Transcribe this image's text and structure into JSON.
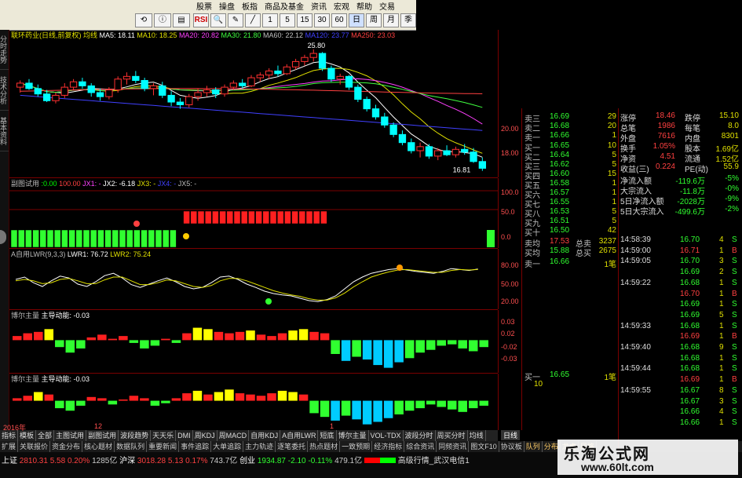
{
  "menu": [
    "股票",
    "操盘",
    "板指",
    "商品及基金",
    "资讯",
    "宏观",
    "帮助",
    "交易"
  ],
  "toolbar": {
    "buttons": [
      "RSI",
      "Q",
      "1",
      "5",
      "15",
      "30",
      "60",
      "日",
      "周",
      "月",
      "季",
      "年"
    ]
  },
  "sidebar": {
    "tabs": [
      "分时走势",
      "技术分析",
      "基本资料"
    ]
  },
  "main_chart": {
    "title": "联环药业(日线,前复权) 均线",
    "ma": [
      {
        "label": "MA5: 18.11",
        "color": "#ffffff"
      },
      {
        "label": "MA10: 18.25",
        "color": "#e0e000"
      },
      {
        "label": "MA20: 20.82",
        "color": "#ff40ff"
      },
      {
        "label": "MA30: 21.80",
        "color": "#40ff40"
      },
      {
        "label": "MA60: 22.12",
        "color": "#c0c0c0"
      },
      {
        "label": "MA120: 23.77",
        "color": "#4040ff"
      },
      {
        "label": "MA250: 23.03",
        "color": "#ff4040"
      }
    ],
    "high_label": "25.80",
    "low_label": "16.81",
    "y_ticks": [
      "20.00",
      "18.00"
    ],
    "candles": [
      [
        23.0,
        23.5,
        22.6,
        23.3
      ],
      [
        23.3,
        23.6,
        22.8,
        22.9
      ],
      [
        22.9,
        23.2,
        22.3,
        22.5
      ],
      [
        22.5,
        22.8,
        21.9,
        22.0
      ],
      [
        22.0,
        22.6,
        21.8,
        22.4
      ],
      [
        22.4,
        23.3,
        22.2,
        23.0
      ],
      [
        23.0,
        23.6,
        22.8,
        23.4
      ],
      [
        23.4,
        23.7,
        22.9,
        23.1
      ],
      [
        23.1,
        23.3,
        22.3,
        22.6
      ],
      [
        22.6,
        22.9,
        22.0,
        22.3
      ],
      [
        22.3,
        23.0,
        22.1,
        22.8
      ],
      [
        22.8,
        23.8,
        22.6,
        23.6
      ],
      [
        23.6,
        24.1,
        23.2,
        23.8
      ],
      [
        23.8,
        24.2,
        23.3,
        23.5
      ],
      [
        23.5,
        23.7,
        22.7,
        22.9
      ],
      [
        22.9,
        23.3,
        22.4,
        23.1
      ],
      [
        23.1,
        23.4,
        22.2,
        22.4
      ],
      [
        22.4,
        22.7,
        21.6,
        21.9
      ],
      [
        21.9,
        22.2,
        21.4,
        21.7
      ],
      [
        21.7,
        22.5,
        21.5,
        22.3
      ],
      [
        22.3,
        22.9,
        22.0,
        22.6
      ],
      [
        22.6,
        23.1,
        22.3,
        22.8
      ],
      [
        22.8,
        23.0,
        22.2,
        22.5
      ],
      [
        22.5,
        23.2,
        22.3,
        23.0
      ],
      [
        23.0,
        23.5,
        22.8,
        23.3
      ],
      [
        23.3,
        23.6,
        22.9,
        23.1
      ],
      [
        23.1,
        23.9,
        23.0,
        23.7
      ],
      [
        23.7,
        24.1,
        23.4,
        23.9
      ],
      [
        23.9,
        24.4,
        23.6,
        24.2
      ],
      [
        24.2,
        24.6,
        23.8,
        24.0
      ],
      [
        24.0,
        24.7,
        23.9,
        24.5
      ],
      [
        24.5,
        25.1,
        24.3,
        24.9
      ],
      [
        24.9,
        25.4,
        24.6,
        25.2
      ],
      [
        25.2,
        25.8,
        24.9,
        25.5
      ],
      [
        25.5,
        25.6,
        24.2,
        24.4
      ],
      [
        24.4,
        24.6,
        23.4,
        23.6
      ],
      [
        23.6,
        24.0,
        23.2,
        23.8
      ],
      [
        23.8,
        23.9,
        22.8,
        23.0
      ],
      [
        23.0,
        23.2,
        21.9,
        22.1
      ],
      [
        22.1,
        22.3,
        21.2,
        21.4
      ],
      [
        21.4,
        21.7,
        20.6,
        20.8
      ],
      [
        20.8,
        21.1,
        20.0,
        20.2
      ],
      [
        20.2,
        20.4,
        19.3,
        19.5
      ],
      [
        19.5,
        19.8,
        18.7,
        18.9
      ],
      [
        18.9,
        19.2,
        18.1,
        18.3
      ],
      [
        18.3,
        18.9,
        17.8,
        18.6
      ],
      [
        18.6,
        18.8,
        17.7,
        17.9
      ],
      [
        17.9,
        18.5,
        17.6,
        18.3
      ],
      [
        18.3,
        18.7,
        17.9,
        18.0
      ],
      [
        18.0,
        18.6,
        17.8,
        18.4
      ],
      [
        18.4,
        18.8,
        18.0,
        18.2
      ],
      [
        18.2,
        18.5,
        17.4,
        17.5
      ],
      [
        17.5,
        17.8,
        16.81,
        17.0
      ]
    ]
  },
  "sub1": {
    "title": "副图试用",
    "values": [
      ":0.00",
      "100.00",
      "JX1: -",
      "JX2: -6.18",
      "JX3: -",
      "JX4: -",
      "JX5: -"
    ],
    "y_ticks": [
      "100.0",
      "50.0",
      "0.0"
    ],
    "bars": [
      -1,
      -1,
      -1,
      -1,
      -1,
      -1,
      -1,
      -1,
      -1,
      -1,
      -1,
      -1,
      -1,
      -1,
      -1,
      -1,
      -1,
      -1,
      -1,
      -1,
      -1,
      -1,
      -1,
      1,
      1,
      1,
      1,
      1,
      1,
      1,
      1,
      1,
      1,
      1,
      1,
      1,
      1,
      1,
      1,
      1,
      1,
      1,
      1
    ]
  },
  "sub2": {
    "title": "A自用LWR(9,3,3)",
    "values": [
      "LWR1: 76.72",
      "LWR2: 75.24"
    ],
    "y_ticks": [
      "80.00",
      "50.00",
      "20.00"
    ],
    "lwr1": [
      55,
      60,
      48,
      40,
      52,
      62,
      58,
      45,
      40,
      50,
      63,
      68,
      58,
      44,
      38,
      45,
      52,
      58,
      50,
      40,
      35,
      38,
      48,
      60,
      62,
      55,
      45,
      38,
      30,
      25,
      22,
      20,
      15,
      10,
      8,
      12,
      20,
      35,
      50,
      60,
      68,
      72,
      76,
      78,
      75,
      72,
      70,
      68,
      72,
      78,
      76,
      74,
      77
    ],
    "lwr2": [
      52,
      55,
      52,
      46,
      48,
      55,
      57,
      52,
      46,
      46,
      54,
      60,
      60,
      52,
      44,
      44,
      48,
      54,
      52,
      46,
      40,
      38,
      42,
      52,
      57,
      57,
      52,
      45,
      38,
      31,
      26,
      22,
      19,
      14,
      11,
      11,
      16,
      26,
      39,
      50,
      60,
      66,
      71,
      75,
      76,
      74,
      72,
      70,
      70,
      74,
      76,
      75,
      76
    ]
  },
  "sub3": {
    "title": "博尔主量",
    "values": [
      "主导动能: -0.03"
    ],
    "y_ticks": [
      "0.03",
      "0.02",
      "-0.02",
      "-0.03"
    ],
    "bars": [
      0.3,
      0.5,
      0.6,
      0.8,
      -0.5,
      -0.9,
      -0.6,
      0.2,
      0.4,
      0.1,
      0.3,
      -0.2,
      -0.6,
      -0.4,
      0.1,
      -0.2,
      0.5,
      0.9,
      0.8,
      0.6,
      0.5,
      0.6,
      0.7,
      0.4,
      0.3,
      0.5,
      0.7,
      0.8,
      0.6,
      0.5,
      -1.0,
      -1.5,
      -1.2,
      -1.4,
      -1.8,
      -2.0,
      -1.6,
      -1.3,
      -0.9,
      -0.7,
      -0.4,
      -0.3,
      -0.6,
      -0.8,
      -0.5
    ]
  },
  "sub4": {
    "title": "博尔主量",
    "values": [
      "主导动能: -0.03"
    ],
    "bars": [
      0.2,
      0.4,
      0.7,
      0.5,
      -0.6,
      -0.8,
      -0.4,
      0.3,
      0.2,
      -0.3,
      0.1,
      0.4,
      0.2,
      -0.4,
      -0.2,
      0.2,
      0.6,
      0.8,
      0.5,
      0.7,
      0.9,
      0.6,
      0.5,
      0.4,
      0.6,
      0.8,
      0.7,
      0.5,
      -1.0,
      -1.3,
      -1.6,
      -1.2,
      -1.5,
      -1.9,
      -1.7,
      -1.4,
      -1.1,
      -0.8,
      -0.6,
      -0.3,
      -0.5,
      -0.7,
      -0.9,
      -0.6,
      -0.4
    ]
  },
  "time_axis": {
    "labels": [
      "2016年",
      "12",
      "1"
    ],
    "period": "日线"
  },
  "order_book": {
    "asks": [
      {
        "label": "卖三",
        "price": "16.69",
        "vol": "29"
      },
      {
        "label": "卖二",
        "price": "16.68",
        "vol": "20"
      },
      {
        "label": "卖一",
        "price": "16.66",
        "vol": "1"
      }
    ],
    "bids": [
      {
        "label": "买一",
        "price": "16.65",
        "vol": "10"
      },
      {
        "label": "买二",
        "price": "16.64",
        "vol": "5"
      },
      {
        "label": "买三",
        "price": "16.62",
        "vol": "5"
      },
      {
        "label": "买四",
        "price": "16.60",
        "vol": "15"
      },
      {
        "label": "买五",
        "price": "16.58",
        "vol": "1"
      },
      {
        "label": "买六",
        "price": "16.57",
        "vol": "1"
      },
      {
        "label": "买七",
        "price": "16.55",
        "vol": "1"
      },
      {
        "label": "买八",
        "price": "16.53",
        "vol": "5"
      },
      {
        "label": "买九",
        "price": "16.51",
        "vol": "5"
      },
      {
        "label": "买十",
        "price": "16.50",
        "vol": "42"
      }
    ],
    "avg_ask": {
      "label": "卖均",
      "price": "17.53",
      "total_label": "总卖",
      "total": "3237"
    },
    "avg_bid": {
      "label": "买均",
      "price": "15.88",
      "total_label": "总买",
      "total": "2675"
    },
    "ask1_detail": {
      "label": "卖一",
      "price": "16.66",
      "vol": "1笔"
    },
    "bid1_detail": {
      "label": "买一",
      "price": "16.65",
      "vol": "1笔",
      "sub": "10"
    }
  },
  "stats": [
    {
      "a": "涨停",
      "b": "18.46",
      "c": "跌停",
      "d": "15.10"
    },
    {
      "a": "总笔",
      "b": "1986",
      "c": "每笔",
      "d": "8.0"
    },
    {
      "a": "外盘",
      "b": "7616",
      "c": "内盘",
      "d": "8301"
    },
    {
      "a": "换手",
      "b": "1.05%",
      "c": "股本",
      "d": "1.69亿"
    },
    {
      "a": "净资",
      "b": "4.51",
      "c": "流通",
      "d": "1.52亿"
    },
    {
      "a": "收益(三)",
      "b": "0.224",
      "c": "PE(动)",
      "d": "55.9"
    }
  ],
  "flows": [
    {
      "a": "净流入额",
      "b": "-119.6万",
      "c": "-5%"
    },
    {
      "a": "大宗流入",
      "b": "-11.8万",
      "c": "-0%"
    },
    {
      "a": "5日净流入额",
      "b": "-2028万",
      "c": "-9%"
    },
    {
      "a": "5日大宗流入",
      "b": "-499.6万",
      "c": "-2%"
    }
  ],
  "ticks": [
    {
      "t": "14:58:39",
      "p": "16.70",
      "v": "4",
      "d": "S"
    },
    {
      "t": "14:59:00",
      "p": "16.71",
      "v": "1",
      "d": "B"
    },
    {
      "t": "14:59:05",
      "p": "16.70",
      "v": "3",
      "d": "S"
    },
    {
      "t": "",
      "p": "16.69",
      "v": "2",
      "d": "S"
    },
    {
      "t": "14:59:22",
      "p": "16.68",
      "v": "1",
      "d": "S"
    },
    {
      "t": "",
      "p": "16.70",
      "v": "1",
      "d": "B"
    },
    {
      "t": "",
      "p": "16.69",
      "v": "1",
      "d": "S"
    },
    {
      "t": "",
      "p": "16.69",
      "v": "5",
      "d": "S"
    },
    {
      "t": "14:59:33",
      "p": "16.68",
      "v": "1",
      "d": "S"
    },
    {
      "t": "",
      "p": "16.69",
      "v": "1",
      "d": "B"
    },
    {
      "t": "14:59:40",
      "p": "16.68",
      "v": "9",
      "d": "S"
    },
    {
      "t": "",
      "p": "16.68",
      "v": "1",
      "d": "S"
    },
    {
      "t": "14:59:44",
      "p": "16.68",
      "v": "1",
      "d": "S"
    },
    {
      "t": "",
      "p": "16.69",
      "v": "1",
      "d": "B"
    },
    {
      "t": "14:59:55",
      "p": "16.67",
      "v": "8",
      "d": "S"
    },
    {
      "t": "",
      "p": "16.67",
      "v": "3",
      "d": "S"
    },
    {
      "t": "",
      "p": "16.66",
      "v": "4",
      "d": "S"
    },
    {
      "t": "",
      "p": "16.66",
      "v": "1",
      "d": "S"
    }
  ],
  "bottom_tabs": [
    "指标",
    "模板",
    "全部",
    "主图试用",
    "副图试用",
    "波段趋势",
    "天天乐",
    "DMI",
    "周KDJ",
    "周MACD",
    "自用KDJ",
    "A自用LWR",
    "短底",
    "博尔主量",
    "VOL-TDX",
    "波段分时",
    "周买分时",
    "均线",
    "分时追击"
  ],
  "sub_tabs": [
    "扩展",
    "关联报价",
    "资金分布",
    "核心题材",
    "数据队列",
    "重要新闻",
    "事件追踪",
    "大单追踪",
    "主力轨迹",
    "逐笔委托",
    "热点题材",
    "一致预期",
    "经济指标",
    "综合资讯",
    "同频资讯",
    "图文F10",
    "协议板"
  ],
  "right_tabs": [
    "队列",
    "分布",
    "龙虎",
    "风格"
  ],
  "status": {
    "sh_label": "上证",
    "sh_val": "2810.31",
    "sh_chg": "5.58",
    "sh_pct": "0.20%",
    "sh_amt": "1285亿",
    "sz_label": "沪深",
    "sz_val": "3018.28",
    "sz_chg": "5.13",
    "sz_pct": "0.17%",
    "sz_amt": "743.7亿",
    "cy_label": "创业",
    "cy_val": "1934.87",
    "cy_chg": "-2.10",
    "cy_pct": "-0.11%",
    "cy_amt": "479.1亿",
    "server": "高级行情_武汉电信1"
  },
  "watermark": {
    "title": "乐淘公式网",
    "url": "www.60lt.com"
  },
  "colors": {
    "up": "#ff3030",
    "down": "#00ffff",
    "green": "#30ff30",
    "yellow": "#ffff00",
    "axis": "#7a0000"
  }
}
